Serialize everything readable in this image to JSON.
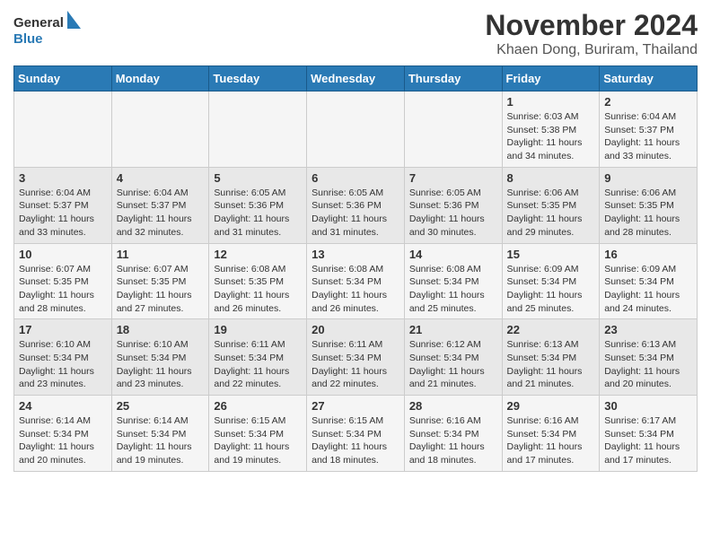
{
  "header": {
    "logo_general": "General",
    "logo_blue": "Blue",
    "main_title": "November 2024",
    "sub_title": "Khaen Dong, Buriram, Thailand"
  },
  "calendar": {
    "days_of_week": [
      "Sunday",
      "Monday",
      "Tuesday",
      "Wednesday",
      "Thursday",
      "Friday",
      "Saturday"
    ],
    "weeks": [
      [
        {
          "day": "",
          "info": ""
        },
        {
          "day": "",
          "info": ""
        },
        {
          "day": "",
          "info": ""
        },
        {
          "day": "",
          "info": ""
        },
        {
          "day": "",
          "info": ""
        },
        {
          "day": "1",
          "info": "Sunrise: 6:03 AM\nSunset: 5:38 PM\nDaylight: 11 hours\nand 34 minutes."
        },
        {
          "day": "2",
          "info": "Sunrise: 6:04 AM\nSunset: 5:37 PM\nDaylight: 11 hours\nand 33 minutes."
        }
      ],
      [
        {
          "day": "3",
          "info": "Sunrise: 6:04 AM\nSunset: 5:37 PM\nDaylight: 11 hours\nand 33 minutes."
        },
        {
          "day": "4",
          "info": "Sunrise: 6:04 AM\nSunset: 5:37 PM\nDaylight: 11 hours\nand 32 minutes."
        },
        {
          "day": "5",
          "info": "Sunrise: 6:05 AM\nSunset: 5:36 PM\nDaylight: 11 hours\nand 31 minutes."
        },
        {
          "day": "6",
          "info": "Sunrise: 6:05 AM\nSunset: 5:36 PM\nDaylight: 11 hours\nand 31 minutes."
        },
        {
          "day": "7",
          "info": "Sunrise: 6:05 AM\nSunset: 5:36 PM\nDaylight: 11 hours\nand 30 minutes."
        },
        {
          "day": "8",
          "info": "Sunrise: 6:06 AM\nSunset: 5:35 PM\nDaylight: 11 hours\nand 29 minutes."
        },
        {
          "day": "9",
          "info": "Sunrise: 6:06 AM\nSunset: 5:35 PM\nDaylight: 11 hours\nand 28 minutes."
        }
      ],
      [
        {
          "day": "10",
          "info": "Sunrise: 6:07 AM\nSunset: 5:35 PM\nDaylight: 11 hours\nand 28 minutes."
        },
        {
          "day": "11",
          "info": "Sunrise: 6:07 AM\nSunset: 5:35 PM\nDaylight: 11 hours\nand 27 minutes."
        },
        {
          "day": "12",
          "info": "Sunrise: 6:08 AM\nSunset: 5:35 PM\nDaylight: 11 hours\nand 26 minutes."
        },
        {
          "day": "13",
          "info": "Sunrise: 6:08 AM\nSunset: 5:34 PM\nDaylight: 11 hours\nand 26 minutes."
        },
        {
          "day": "14",
          "info": "Sunrise: 6:08 AM\nSunset: 5:34 PM\nDaylight: 11 hours\nand 25 minutes."
        },
        {
          "day": "15",
          "info": "Sunrise: 6:09 AM\nSunset: 5:34 PM\nDaylight: 11 hours\nand 25 minutes."
        },
        {
          "day": "16",
          "info": "Sunrise: 6:09 AM\nSunset: 5:34 PM\nDaylight: 11 hours\nand 24 minutes."
        }
      ],
      [
        {
          "day": "17",
          "info": "Sunrise: 6:10 AM\nSunset: 5:34 PM\nDaylight: 11 hours\nand 23 minutes."
        },
        {
          "day": "18",
          "info": "Sunrise: 6:10 AM\nSunset: 5:34 PM\nDaylight: 11 hours\nand 23 minutes."
        },
        {
          "day": "19",
          "info": "Sunrise: 6:11 AM\nSunset: 5:34 PM\nDaylight: 11 hours\nand 22 minutes."
        },
        {
          "day": "20",
          "info": "Sunrise: 6:11 AM\nSunset: 5:34 PM\nDaylight: 11 hours\nand 22 minutes."
        },
        {
          "day": "21",
          "info": "Sunrise: 6:12 AM\nSunset: 5:34 PM\nDaylight: 11 hours\nand 21 minutes."
        },
        {
          "day": "22",
          "info": "Sunrise: 6:13 AM\nSunset: 5:34 PM\nDaylight: 11 hours\nand 21 minutes."
        },
        {
          "day": "23",
          "info": "Sunrise: 6:13 AM\nSunset: 5:34 PM\nDaylight: 11 hours\nand 20 minutes."
        }
      ],
      [
        {
          "day": "24",
          "info": "Sunrise: 6:14 AM\nSunset: 5:34 PM\nDaylight: 11 hours\nand 20 minutes."
        },
        {
          "day": "25",
          "info": "Sunrise: 6:14 AM\nSunset: 5:34 PM\nDaylight: 11 hours\nand 19 minutes."
        },
        {
          "day": "26",
          "info": "Sunrise: 6:15 AM\nSunset: 5:34 PM\nDaylight: 11 hours\nand 19 minutes."
        },
        {
          "day": "27",
          "info": "Sunrise: 6:15 AM\nSunset: 5:34 PM\nDaylight: 11 hours\nand 18 minutes."
        },
        {
          "day": "28",
          "info": "Sunrise: 6:16 AM\nSunset: 5:34 PM\nDaylight: 11 hours\nand 18 minutes."
        },
        {
          "day": "29",
          "info": "Sunrise: 6:16 AM\nSunset: 5:34 PM\nDaylight: 11 hours\nand 17 minutes."
        },
        {
          "day": "30",
          "info": "Sunrise: 6:17 AM\nSunset: 5:34 PM\nDaylight: 11 hours\nand 17 minutes."
        }
      ]
    ]
  }
}
